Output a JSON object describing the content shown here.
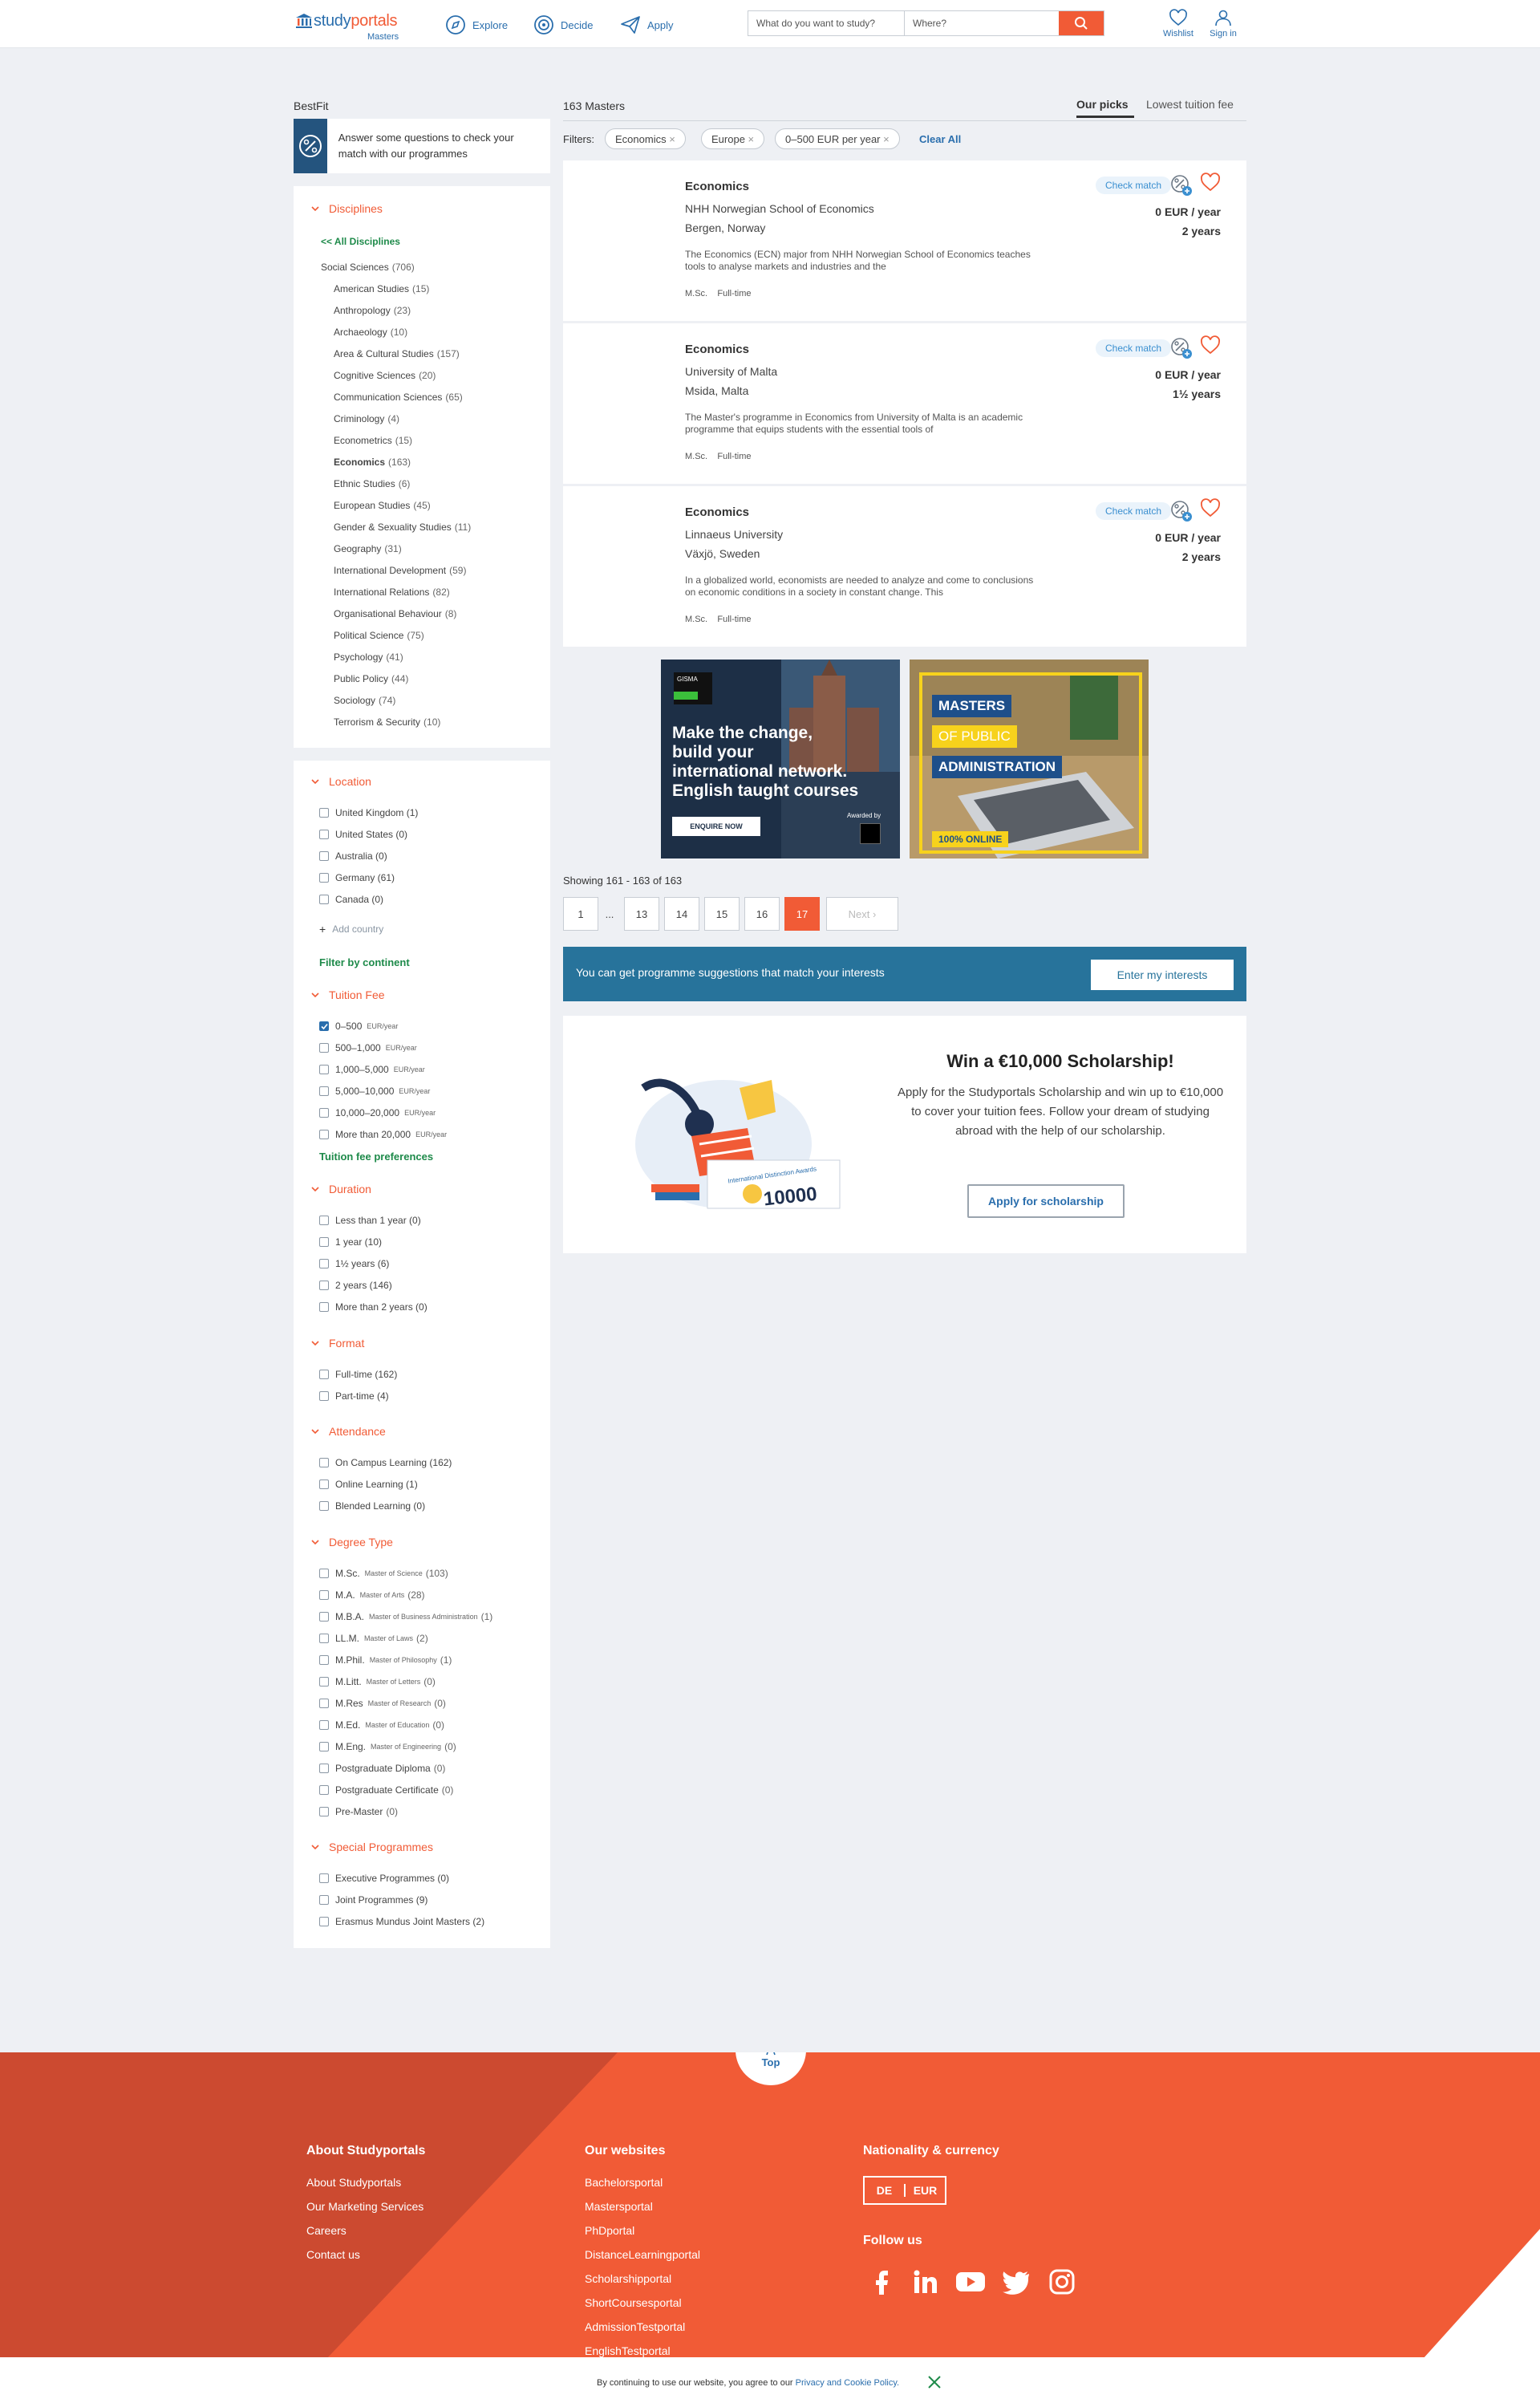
{
  "header": {
    "logo_main": "study",
    "logo_accent": "portals",
    "logo_sub": "Masters",
    "nav": [
      "Explore",
      "Decide",
      "Apply"
    ],
    "search_what_placeholder": "What do you want to study?",
    "search_where_placeholder": "Where?",
    "wishlist": "Wishlist",
    "signin": "Sign in"
  },
  "sidebar": {
    "bestfit_title": "BestFit",
    "bestfit_text": "Answer some questions to check your match with our programmes",
    "disciplines_title": "Disciplines",
    "all_disciplines": "<< All Disciplines",
    "parent": {
      "label": "Social Sciences",
      "count": "(706)"
    },
    "disciplines": [
      {
        "label": "American Studies",
        "count": "(15)"
      },
      {
        "label": "Anthropology",
        "count": "(23)"
      },
      {
        "label": "Archaeology",
        "count": "(10)"
      },
      {
        "label": "Area & Cultural Studies",
        "count": "(157)"
      },
      {
        "label": "Cognitive Sciences",
        "count": "(20)"
      },
      {
        "label": "Communication Sciences",
        "count": "(65)"
      },
      {
        "label": "Criminology",
        "count": "(4)"
      },
      {
        "label": "Econometrics",
        "count": "(15)"
      },
      {
        "label": "Economics",
        "count": "(163)"
      },
      {
        "label": "Ethnic Studies",
        "count": "(6)"
      },
      {
        "label": "European Studies",
        "count": "(45)"
      },
      {
        "label": "Gender & Sexuality Studies",
        "count": "(11)"
      },
      {
        "label": "Geography",
        "count": "(31)"
      },
      {
        "label": "International Development",
        "count": "(59)"
      },
      {
        "label": "International Relations",
        "count": "(82)"
      },
      {
        "label": "Organisational Behaviour",
        "count": "(8)"
      },
      {
        "label": "Political Science",
        "count": "(75)"
      },
      {
        "label": "Psychology",
        "count": "(41)"
      },
      {
        "label": "Public Policy",
        "count": "(44)"
      },
      {
        "label": "Sociology",
        "count": "(74)"
      },
      {
        "label": "Terrorism & Security",
        "count": "(10)"
      }
    ],
    "location_title": "Location",
    "locations": [
      "United Kingdom (1)",
      "United States (0)",
      "Australia (0)",
      "Germany (61)",
      "Canada (0)"
    ],
    "add_country": "Add country",
    "filter_continent": "Filter by continent",
    "tuition_title": "Tuition Fee",
    "tuition": [
      {
        "label": "0–500",
        "note": "EUR/year",
        "checked": true
      },
      {
        "label": "500–1,000",
        "note": "EUR/year",
        "checked": false
      },
      {
        "label": "1,000–5,000",
        "note": "EUR/year",
        "checked": false
      },
      {
        "label": "5,000–10,000",
        "note": "EUR/year",
        "checked": false
      },
      {
        "label": "10,000–20,000",
        "note": "EUR/year",
        "checked": false
      },
      {
        "label": "More than 20,000",
        "note": "EUR/year",
        "checked": false
      }
    ],
    "tuition_prefs": "Tuition fee preferences",
    "duration_title": "Duration",
    "durations": [
      "Less than 1 year (0)",
      "1 year (10)",
      "1½ years (6)",
      "2 years (146)",
      "More than 2 years (0)"
    ],
    "format_title": "Format",
    "formats": [
      "Full-time (162)",
      "Part-time (4)"
    ],
    "attendance_title": "Attendance",
    "attendance": [
      "On Campus Learning (162)",
      "Online Learning (1)",
      "Blended Learning (0)"
    ],
    "degree_title": "Degree Type",
    "degrees": [
      {
        "label": "M.Sc.",
        "note": "Master of Science",
        "count": "(103)"
      },
      {
        "label": "M.A.",
        "note": "Master of Arts",
        "count": "(28)"
      },
      {
        "label": "M.B.A.",
        "note": "Master of Business Administration",
        "count": "(1)"
      },
      {
        "label": "LL.M.",
        "note": "Master of Laws",
        "count": "(2)"
      },
      {
        "label": "M.Phil.",
        "note": "Master of Philosophy",
        "count": "(1)"
      },
      {
        "label": "M.Litt.",
        "note": "Master of Letters",
        "count": "(0)"
      },
      {
        "label": "M.Res",
        "note": "Master of Research",
        "count": "(0)"
      },
      {
        "label": "M.Ed.",
        "note": "Master of Education",
        "count": "(0)"
      },
      {
        "label": "M.Eng.",
        "note": "Master of Engineering",
        "count": "(0)"
      },
      {
        "label": "Postgraduate Diploma",
        "note": "",
        "count": "(0)"
      },
      {
        "label": "Postgraduate Certificate",
        "note": "",
        "count": "(0)"
      },
      {
        "label": "Pre-Master",
        "note": "",
        "count": "(0)"
      }
    ],
    "special_title": "Special Programmes",
    "special": [
      "Executive Programmes (0)",
      "Joint Programmes (9)",
      "Erasmus Mundus Joint Masters (2)"
    ]
  },
  "results": {
    "count": "163 Masters",
    "tab_picks": "Our picks",
    "tab_lowest": "Lowest tuition fee",
    "filters_label": "Filters:",
    "chips": [
      "Economics",
      "Europe",
      "0–500 EUR per year"
    ],
    "clear_all": "Clear All",
    "check_match": "Check match",
    "cards": [
      {
        "title": "Economics",
        "uni": "NHH Norwegian School of Economics",
        "loc": "Bergen, Norway",
        "desc": "The Economics (ECN) major from NHH Norwegian School of Economics teaches tools to analyse markets and industries and the",
        "degree": "M.Sc.",
        "format": "Full-time",
        "fee": "0 EUR / year",
        "duration": "2 years"
      },
      {
        "title": "Economics",
        "uni": "University of Malta",
        "loc": "Msida, Malta",
        "desc": "The Master's programme in Economics from University of Malta is an academic programme that equips students with the essential tools of",
        "degree": "M.Sc.",
        "format": "Full-time",
        "fee": "0 EUR / year",
        "duration": "1½ years"
      },
      {
        "title": "Economics",
        "uni": "Linnaeus University",
        "loc": "Växjö, Sweden",
        "desc": "In a globalized world, economists are needed to analyze and come to conclusions on economic conditions in a society in constant change. This",
        "degree": "M.Sc.",
        "format": "Full-time",
        "fee": "0 EUR / year",
        "duration": "2 years"
      }
    ],
    "ad1": {
      "brand": "GISMA",
      "line1": "Make the change,",
      "line2": "build your",
      "line3": "international network.",
      "line4": "English taught courses",
      "cta": "ENQUIRE NOW",
      "awarded": "Awarded by"
    },
    "ad2": {
      "line1": "MASTERS",
      "line2": "OF PUBLIC",
      "line3": "ADMINISTRATION",
      "badge": "100% ONLINE"
    },
    "showing": "Showing 161 - 163 of 163",
    "pages": [
      "1",
      "...",
      "13",
      "14",
      "15",
      "16",
      "17"
    ],
    "next": "Next",
    "interests_text": "You can get programme suggestions that match your interests",
    "interests_btn": "Enter my interests",
    "scholar_title": "Win a €10,000 Scholarship!",
    "scholar_text": "Apply for the Studyportals Scholarship and win up to €10,000 to cover your tuition fees. Follow your dream of studying abroad with the help of our scholarship.",
    "scholar_btn": "Apply for scholarship",
    "scholar_award": "International Distinction Awards",
    "scholar_amount": "10000"
  },
  "footer": {
    "top": "Top",
    "about_title": "About Studyportals",
    "about_links": [
      "About Studyportals",
      "Our Marketing Services",
      "Careers",
      "Contact us"
    ],
    "websites_title": "Our websites",
    "websites": [
      "Bachelorsportal",
      "Mastersportal",
      "PhDportal",
      "DistanceLearningportal",
      "Scholarshipportal",
      "ShortCoursesportal",
      "AdmissionTestportal",
      "EnglishTestportal"
    ],
    "nat_title": "Nationality & currency",
    "nat": "DE",
    "currency": "EUR",
    "follow": "Follow us",
    "cookie_text": "By continuing to use our website, you agree to our",
    "cookie_link": "Privacy and Cookie Policy."
  },
  "colors": {
    "accent": "#f15b36",
    "brand": "#2a6ead",
    "green": "#1e8a4a",
    "banner": "#27739b"
  }
}
